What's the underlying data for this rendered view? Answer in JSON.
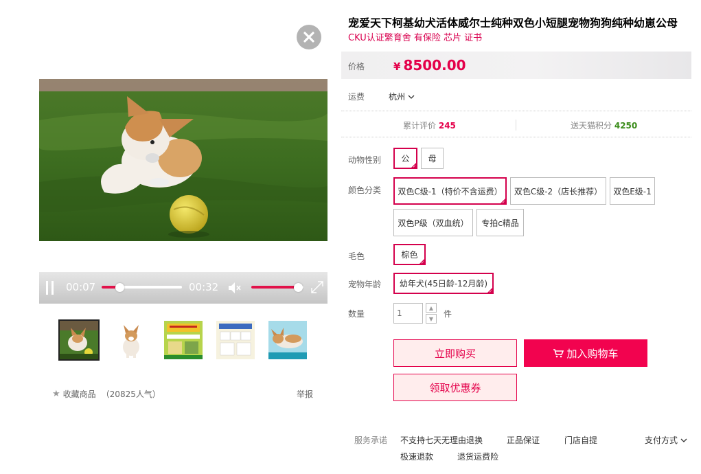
{
  "product": {
    "title": "宠爱天下柯基幼犬活体威尔士纯种双色小短腿宠物狗狗纯种幼崽公母",
    "subtitle": "CKU认证繁育舍 有保险 芯片 证书"
  },
  "video": {
    "current_time": "00:07",
    "duration": "00:32",
    "progress": 0.22,
    "volume": 0.9
  },
  "favorite": {
    "label": "收藏商品",
    "popularity": "（20825人气）",
    "report": "举报"
  },
  "price": {
    "label": "价格",
    "symbol": "¥",
    "value": "8500.00"
  },
  "shipping": {
    "label": "运费",
    "city": "杭州"
  },
  "stats": {
    "reviews_label": "累计评价",
    "reviews_count": "245",
    "points_label": "送天猫积分",
    "points_value": "4250"
  },
  "props": {
    "gender_label": "动物性别",
    "gender_options": [
      "公",
      "母"
    ],
    "color_label": "颜色分类",
    "color_options": [
      "双色C级-1（特价不含运费）",
      "双色C级-2（店长推荐）",
      "双色E级-1",
      "双色P级（双血统）",
      "专拍c精品"
    ],
    "coat_label": "毛色",
    "coat_options": [
      "棕色"
    ],
    "age_label": "宠物年龄",
    "age_options": [
      "幼年犬(45日龄-12月龄)"
    ]
  },
  "quantity": {
    "label": "数量",
    "value": "1",
    "unit": "件"
  },
  "buttons": {
    "buy_now": "立即购买",
    "add_cart": "加入购物车",
    "coupon": "领取优惠券"
  },
  "services": {
    "label": "服务承诺",
    "items": [
      "不支持七天无理由退换",
      "正品保证",
      "门店自提",
      "极速退款",
      "退货运费险"
    ],
    "payment": "支付方式"
  },
  "colors": {
    "accent": "#e4004a",
    "cart_bg": "#f2034f"
  }
}
